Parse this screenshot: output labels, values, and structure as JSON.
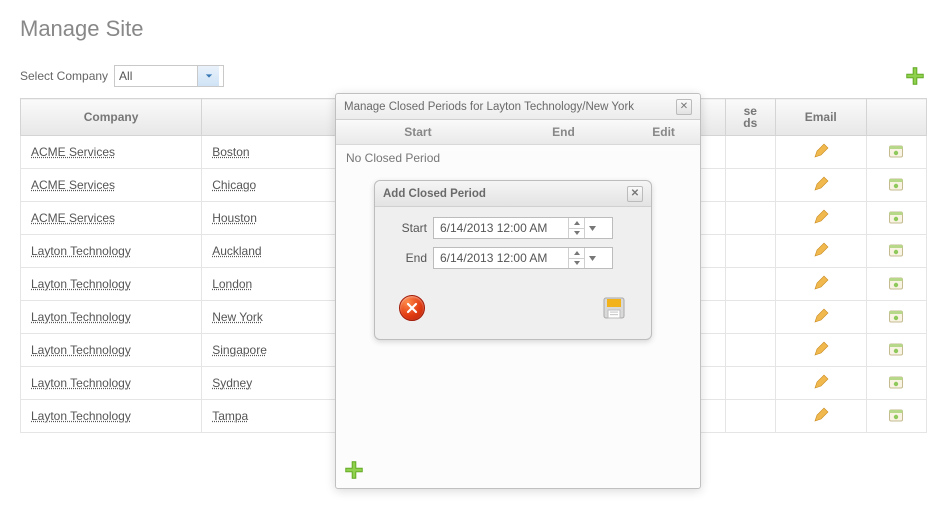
{
  "page_title": "Manage Site",
  "select_company": {
    "label": "Select Company",
    "value": "All"
  },
  "grid": {
    "headers": {
      "company": "Company",
      "email": "Email",
      "close_periods_partial": "se\nds"
    },
    "rows": [
      {
        "company": "ACME Services",
        "site": "Boston"
      },
      {
        "company": "ACME Services",
        "site": "Chicago"
      },
      {
        "company": "ACME Services",
        "site": "Houston"
      },
      {
        "company": "Layton Technology",
        "site": "Auckland"
      },
      {
        "company": "Layton Technology",
        "site": "London"
      },
      {
        "company": "Layton Technology",
        "site": "New York"
      },
      {
        "company": "Layton Technology",
        "site": "Singapore"
      },
      {
        "company": "Layton Technology",
        "site": "Sydney"
      },
      {
        "company": "Layton Technology",
        "site": "Tampa"
      }
    ]
  },
  "periods_modal": {
    "title": "Manage Closed Periods for Layton Technology/New York",
    "columns": {
      "start": "Start",
      "end": "End",
      "edit": "Edit"
    },
    "empty_text": "No Closed Period"
  },
  "add_modal": {
    "title": "Add Closed Period",
    "labels": {
      "start": "Start",
      "end": "End"
    },
    "values": {
      "start": "6/14/2013 12:00 AM",
      "end": "6/14/2013 12:00 AM"
    }
  }
}
